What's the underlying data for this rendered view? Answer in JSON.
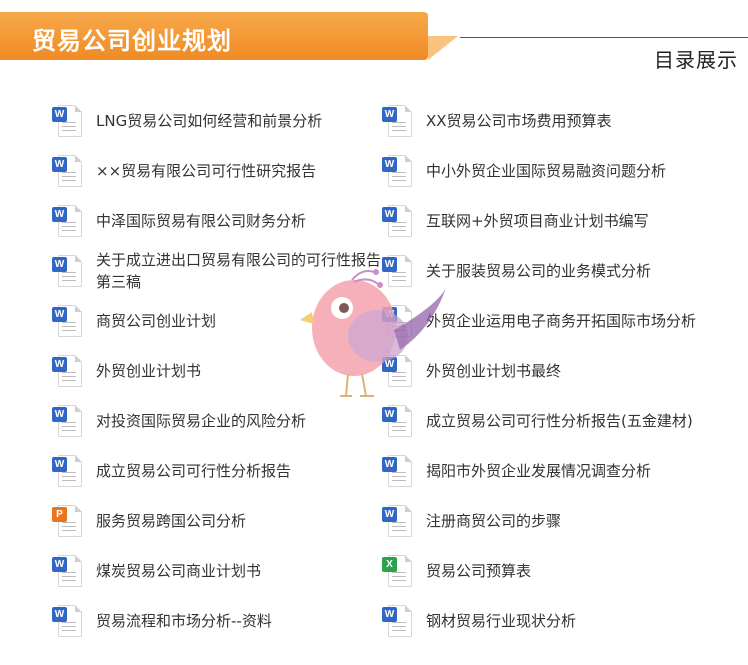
{
  "header": {
    "title": "贸易公司创业规划",
    "subtitle": "目录展示"
  },
  "colors": {
    "banner": "#f08a24",
    "word": "#2f66c8",
    "ppt": "#e9761d",
    "xls": "#2ca34a"
  },
  "items": [
    {
      "label": "LNG贸易公司如何经营和前景分析",
      "type": "word",
      "badge": "W"
    },
    {
      "label": "XX贸易公司市场费用预算表",
      "type": "word",
      "badge": "W"
    },
    {
      "label": "××贸易有限公司可行性研究报告",
      "type": "word",
      "badge": "W"
    },
    {
      "label": "中小外贸企业国际贸易融资问题分析",
      "type": "word",
      "badge": "W"
    },
    {
      "label": "中泽国际贸易有限公司财务分析",
      "type": "word",
      "badge": "W"
    },
    {
      "label": "互联网+外贸项目商业计划书编写",
      "type": "word",
      "badge": "W"
    },
    {
      "label": "关于成立进出口贸易有限公司的可行性报告第三稿",
      "type": "word",
      "badge": "W"
    },
    {
      "label": "关于服装贸易公司的业务模式分析",
      "type": "word",
      "badge": "W"
    },
    {
      "label": "商贸公司创业计划",
      "type": "word",
      "badge": "W"
    },
    {
      "label": "外贸企业运用电子商务开拓国际市场分析",
      "type": "word",
      "badge": "W"
    },
    {
      "label": "外贸创业计划书",
      "type": "word",
      "badge": "W"
    },
    {
      "label": "外贸创业计划书最终",
      "type": "word",
      "badge": "W"
    },
    {
      "label": "对投资国际贸易企业的风险分析",
      "type": "word",
      "badge": "W"
    },
    {
      "label": "成立贸易公司可行性分析报告(五金建材)",
      "type": "word",
      "badge": "W"
    },
    {
      "label": "成立贸易公司可行性分析报告",
      "type": "word",
      "badge": "W"
    },
    {
      "label": "揭阳市外贸企业发展情况调查分析",
      "type": "word",
      "badge": "W"
    },
    {
      "label": "服务贸易跨国公司分析",
      "type": "ppt",
      "badge": "P"
    },
    {
      "label": "注册商贸公司的步骤",
      "type": "word",
      "badge": "W"
    },
    {
      "label": "煤炭贸易公司商业计划书",
      "type": "word",
      "badge": "W"
    },
    {
      "label": "贸易公司预算表",
      "type": "xls",
      "badge": "X"
    },
    {
      "label": "贸易流程和市场分析--资料",
      "type": "word",
      "badge": "W"
    },
    {
      "label": "钢材贸易行业现状分析",
      "type": "word",
      "badge": "W"
    }
  ]
}
